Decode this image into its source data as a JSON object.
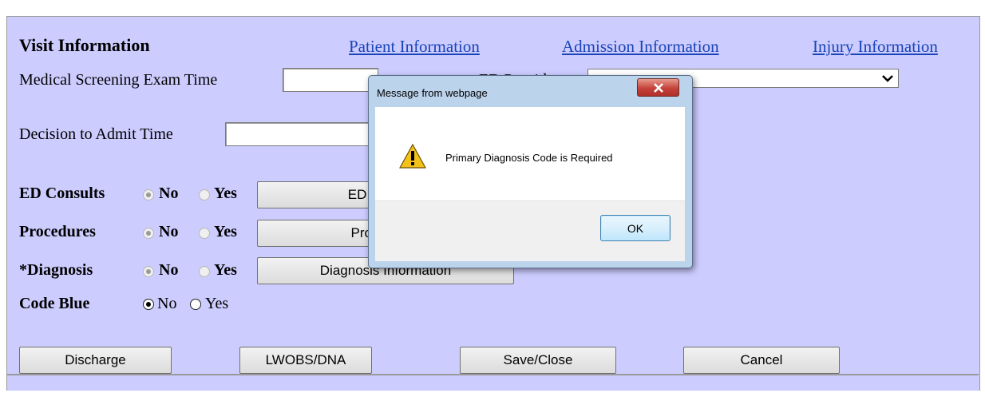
{
  "form": {
    "title": "Visit Information",
    "tabs": [
      "Patient Information",
      "Admission Information",
      "Injury Information"
    ],
    "mse_label": "Medical Screening Exam Time",
    "mse_value": "",
    "ed_provider_label": "ED Provider",
    "ed_provider_value": "",
    "dta_label": "Decision to Admit Time",
    "dta_value": "",
    "rows": [
      {
        "label": "ED Consults",
        "no": "No",
        "yes": "Yes",
        "selected": "No",
        "button": "ED Consults"
      },
      {
        "label": "Procedures",
        "no": "No",
        "yes": "Yes",
        "selected": "No",
        "button": "Procedures"
      },
      {
        "label": "*Diagnosis",
        "no": "No",
        "yes": "Yes",
        "selected": "No",
        "button": "Diagnosis Information"
      },
      {
        "label": "Code Blue",
        "no": "No",
        "yes": "Yes",
        "selected": "No"
      }
    ],
    "buttons": [
      "Discharge",
      "LWOBS/DNA",
      "Save/Close",
      "Cancel"
    ]
  },
  "dialog": {
    "title": "Message from webpage",
    "message": "Primary Diagnosis Code is Required",
    "ok_label": "OK",
    "close_icon": "close-icon",
    "warning_icon": "warning-icon"
  },
  "colors": {
    "form_bg": "#ccccff",
    "link": "#1a44b8",
    "dialog_frame": "#bcd3ec",
    "close_red": "#c4423a"
  }
}
